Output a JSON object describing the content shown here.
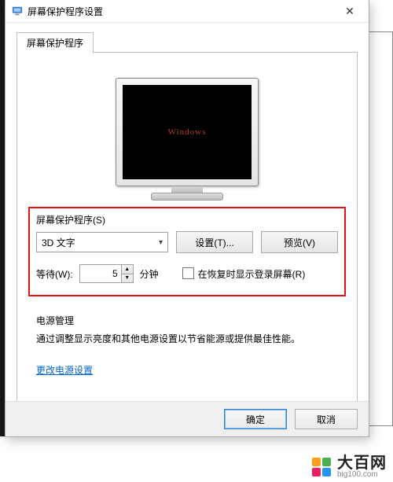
{
  "window": {
    "title": "屏幕保护程序设置",
    "close_glyph": "✕"
  },
  "tab": {
    "label": "屏幕保护程序"
  },
  "preview": {
    "screen_text": "Windows"
  },
  "screensaver": {
    "group_label": "屏幕保护程序(S)",
    "selected": "3D 文字",
    "settings_btn": "设置(T)...",
    "preview_btn": "预览(V)",
    "wait_label": "等待(W):",
    "wait_value": "5",
    "wait_unit": "分钟",
    "resume_label": "在恢复时显示登录屏幕(R)"
  },
  "power": {
    "group_label": "电源管理",
    "description": "通过调整显示亮度和其他电源设置以节省能源或提供最佳性能。",
    "link": "更改电源设置"
  },
  "dialog": {
    "ok": "确定",
    "cancel": "取消"
  },
  "watermark": {
    "cn": "大百网",
    "en": "big100.com"
  }
}
